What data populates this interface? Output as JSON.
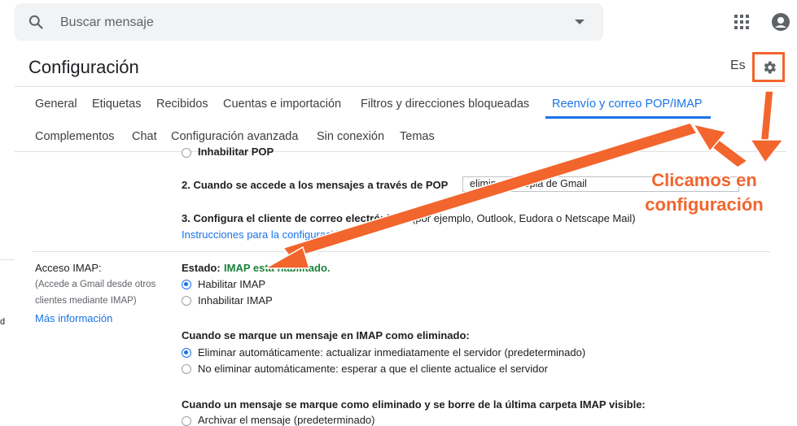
{
  "search": {
    "placeholder": "Buscar mensaje"
  },
  "header": {
    "title": "Configuración",
    "language": "Es"
  },
  "tabs_row1": [
    "General",
    "Etiquetas",
    "Recibidos",
    "Cuentas e importación",
    "Filtros y direcciones bloqueadas",
    "Reenvío y correo POP/IMAP"
  ],
  "tabs_row2": [
    "Complementos",
    "Chat",
    "Configuración avanzada",
    "Sin conexión",
    "Temas"
  ],
  "active_tab": "Reenvío y correo POP/IMAP",
  "pop": {
    "disable_option": "Inhabilitar POP",
    "step2_label": "2. Cuando se accede a los mensajes a través de POP",
    "step2_value": "eliminar la copia de Gmail",
    "step3_label": "3. Configura el cliente de correo electrónico",
    "step3_suffix": "(por ejemplo, Outlook, Eudora o Netscape Mail)",
    "instructions_link": "Instrucciones para la configuración"
  },
  "imap": {
    "section_title": "Acceso IMAP:",
    "section_desc_1": "(Accede a Gmail desde otros",
    "section_desc_2": "clientes mediante IMAP)",
    "more_info_link": "Más información",
    "status_label": "Estado:",
    "status_value": "IMAP está habilitado.",
    "enable_option": "Habilitar IMAP",
    "disable_option": "Inhabilitar IMAP",
    "deleted_heading": "Cuando se marque un mensaje en IMAP como eliminado:",
    "deleted_opt1": "Eliminar automáticamente: actualizar inmediatamente el servidor (predeterminado)",
    "deleted_opt2": "No eliminar automáticamente: esperar a que el cliente actualice el servidor",
    "expunge_heading": "Cuando un mensaje se marque como eliminado y se borre de la última carpeta IMAP visible:",
    "expunge_opt1": "Archivar el mensaje (predeterminado)"
  },
  "annotation": {
    "line1": "Clicamos en",
    "line2": "configuración"
  },
  "edge_text": "d",
  "colors": {
    "accent": "#1a73e8",
    "annotation": "#f2652d",
    "status_ok": "#188038"
  },
  "icons": [
    "search-icon",
    "apps-icon",
    "account-icon",
    "gear-icon"
  ]
}
